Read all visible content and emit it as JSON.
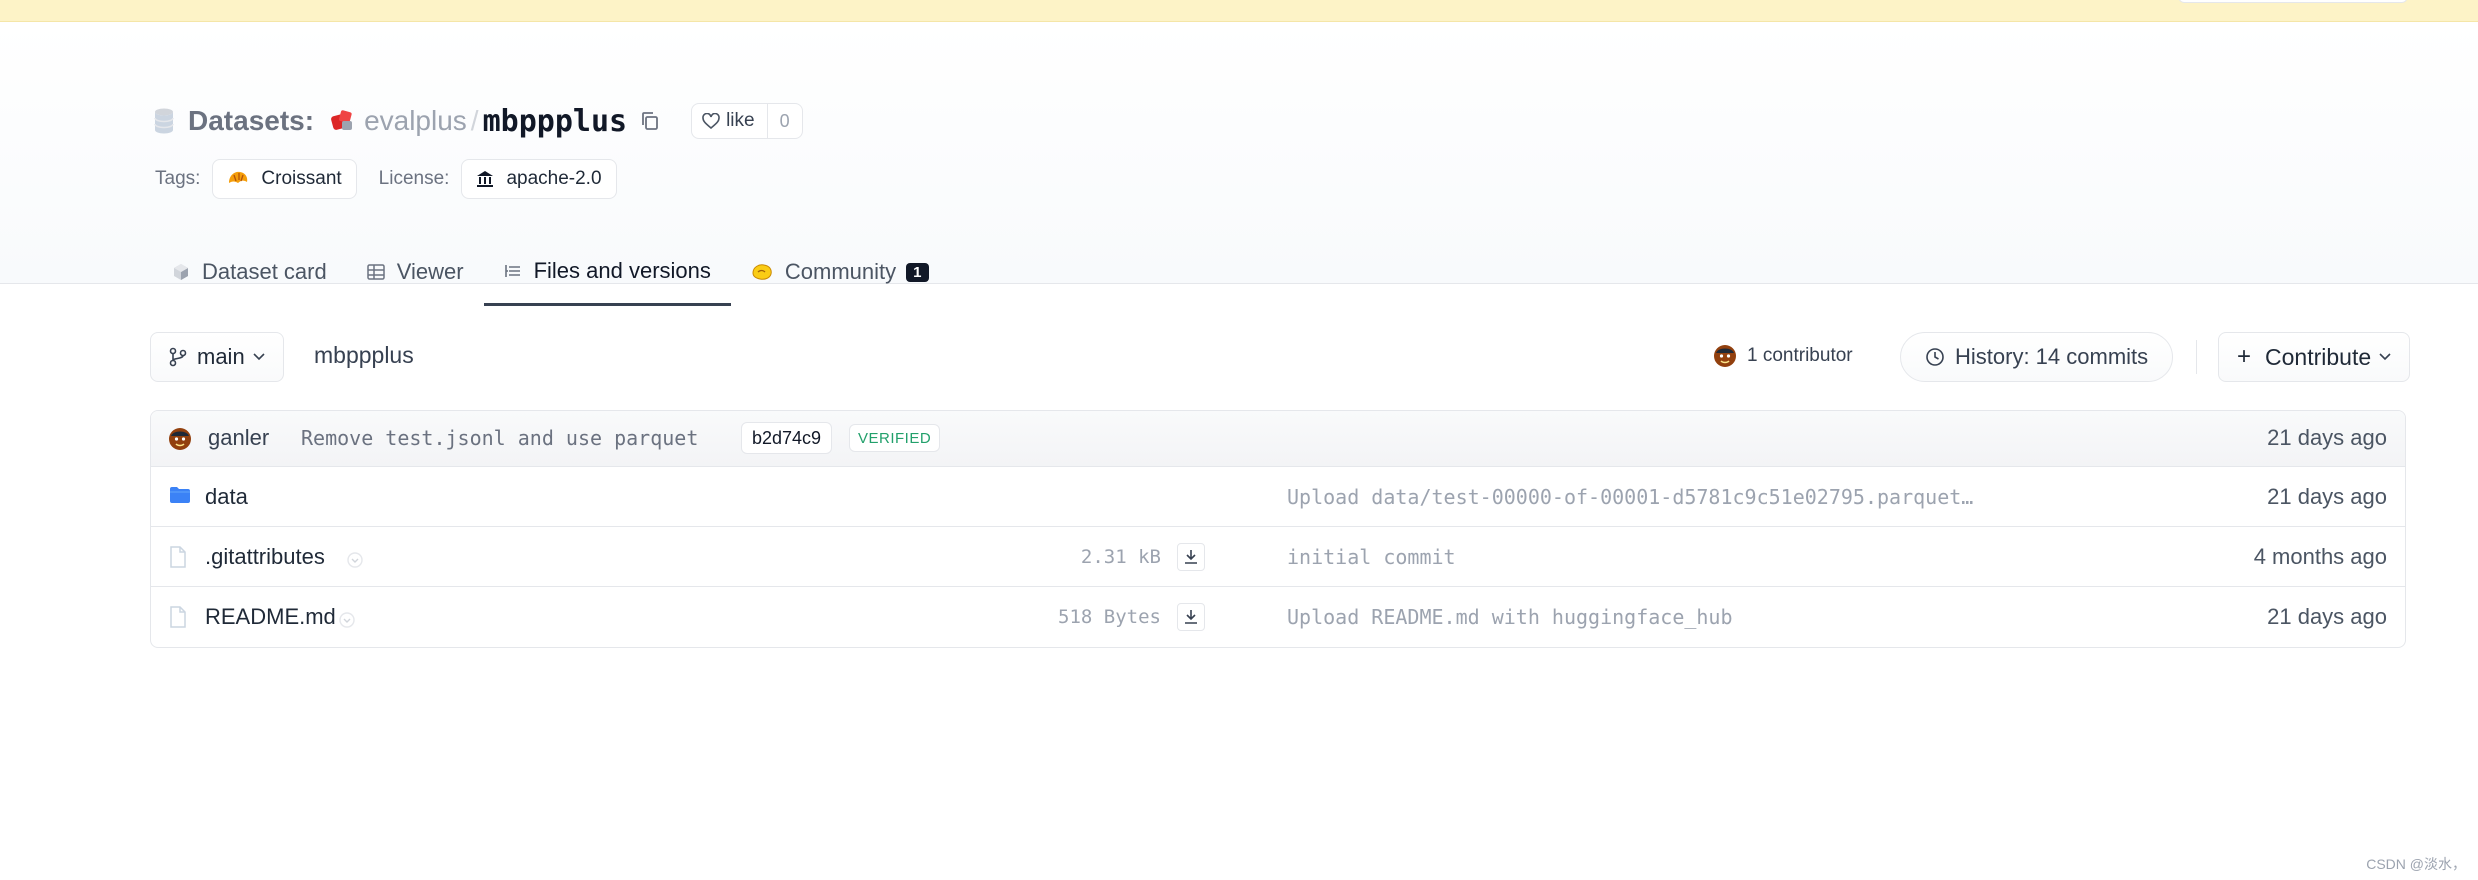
{
  "header": {
    "section_label": "Datasets:",
    "org": "evalplus",
    "separator": "/",
    "repo": "mbppplus",
    "like": {
      "label": "like",
      "count": "0"
    },
    "tags_label": "Tags:",
    "tags": [
      "Croissant"
    ],
    "license_label": "License:",
    "license": "apache-2.0"
  },
  "tabs": [
    {
      "label": "Dataset card",
      "active": false
    },
    {
      "label": "Viewer",
      "active": false
    },
    {
      "label": "Files and versions",
      "active": true
    },
    {
      "label": "Community",
      "active": false,
      "badge": "1"
    }
  ],
  "toolbar": {
    "branch": "main",
    "path": "mbppplus",
    "contributors": "1 contributor",
    "history": "History: 14 commits",
    "contribute": "Contribute",
    "contribute_plus": "+"
  },
  "last_commit": {
    "author": "ganler",
    "message": "Remove test.jsonl and use parquet",
    "hash": "b2d74c9",
    "verified": "VERIFIED",
    "date": "21 days ago"
  },
  "files": [
    {
      "type": "folder",
      "name": "data",
      "size": "",
      "commit": "Upload data/test-00000-of-00001-d5781c9c51e02795.parquet…",
      "date": "21 days ago"
    },
    {
      "type": "file",
      "name": ".gitattributes",
      "size": "2.31 kB",
      "commit": "initial commit",
      "date": "4 months ago"
    },
    {
      "type": "file",
      "name": "README.md",
      "size": "518 Bytes",
      "commit": "Upload README.md with huggingface_hub",
      "date": "21 days ago"
    }
  ],
  "watermark": "CSDN @淡水，",
  "colors": {
    "accent_dark": "#111827",
    "verified_green": "#22a06b",
    "folder_blue": "#3b82f6",
    "banner": "#fdf3c7"
  }
}
